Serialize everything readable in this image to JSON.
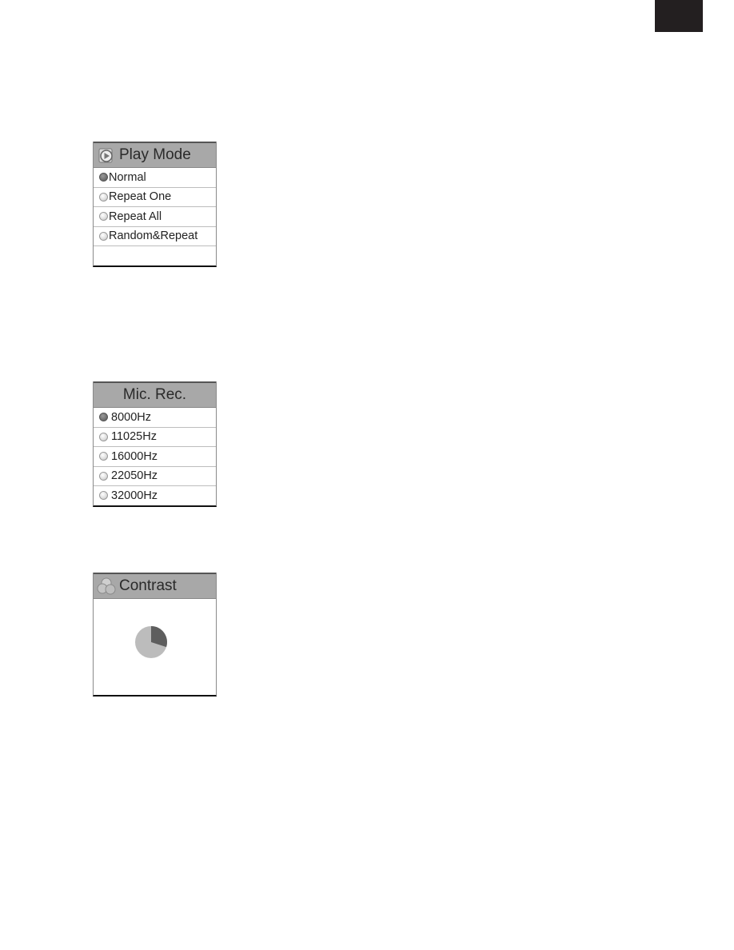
{
  "page": {
    "corner_tab_color": "#231f20"
  },
  "play_mode": {
    "title": "Play Mode",
    "icon": "play-icon",
    "options": [
      {
        "label": "Normal",
        "selected": true
      },
      {
        "label": "Repeat One",
        "selected": false
      },
      {
        "label": "Repeat All",
        "selected": false
      },
      {
        "label": "Random&Repeat",
        "selected": false
      }
    ]
  },
  "mic_rec": {
    "title": "Mic. Rec.",
    "options": [
      {
        "label": "8000Hz",
        "selected": true
      },
      {
        "label": "11025Hz",
        "selected": false
      },
      {
        "label": "16000Hz",
        "selected": false
      },
      {
        "label": "22050Hz",
        "selected": false
      },
      {
        "label": "32000Hz",
        "selected": false
      }
    ]
  },
  "contrast": {
    "title": "Contrast",
    "icon": "cubes-icon",
    "level_fraction": 0.3,
    "colors": {
      "filled": "#5e5e5e",
      "empty": "#bcbcbc"
    }
  }
}
